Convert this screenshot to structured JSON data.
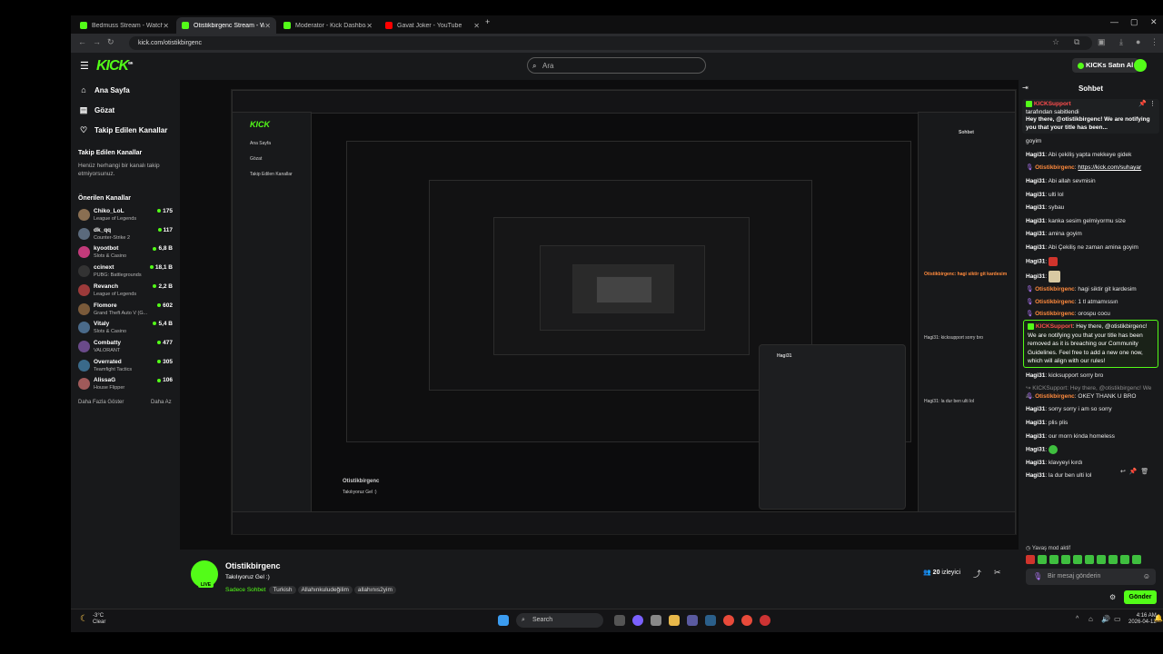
{
  "browser": {
    "tabs": [
      {
        "label": "Bedmuss Stream - Watch Live o",
        "active": false,
        "favicon": "kick-icon"
      },
      {
        "label": "Otistikbirgenc Stream - Watch",
        "active": true,
        "favicon": "kick-icon"
      },
      {
        "label": "Moderator - Kick Dashboard",
        "active": false,
        "favicon": "kick-icon"
      },
      {
        "label": "Gavat Joker - YouTube",
        "active": false,
        "favicon": "youtube-icon"
      }
    ],
    "url": "kick.com/otistikbirgenc"
  },
  "header": {
    "logo": "KICK",
    "logo_sup": "beta",
    "search_placeholder": "Ara",
    "buy_kicks": "KICKs Satın Al"
  },
  "sidebar": {
    "nav": [
      {
        "label": "Ana Sayfa",
        "icon": "home-icon"
      },
      {
        "label": "Gözat",
        "icon": "browse-icon"
      },
      {
        "label": "Takip Edilen Kanallar",
        "icon": "heart-icon"
      }
    ],
    "followed_title": "Takip Edilen Kanallar",
    "followed_empty": "Henüz herhangi bir kanalı takip etmiyorsunuz.",
    "recommended_title": "Önerilen Kanallar",
    "channels": [
      {
        "name": "Chiko_LoL",
        "game": "League of Legends",
        "viewers": "175",
        "color": "#8a6f52"
      },
      {
        "name": "dk_qq",
        "game": "Counter-Strike 2",
        "viewers": "117",
        "color": "#5b6a7c"
      },
      {
        "name": "kyootbot",
        "game": "Slots & Casino",
        "viewers": "6,8 B",
        "color": "#c23a7a"
      },
      {
        "name": "ccinext",
        "game": "PUBG: Battlegrounds",
        "viewers": "18,1 B",
        "color": "#333333"
      },
      {
        "name": "Revanch",
        "game": "League of Legends",
        "viewers": "2,2 B",
        "color": "#9c3a3a"
      },
      {
        "name": "Flomore",
        "game": "Grand Theft Auto V (G...",
        "viewers": "602",
        "color": "#7a5a3a"
      },
      {
        "name": "Vitaly",
        "game": "Slots & Casino",
        "viewers": "5,4 B",
        "color": "#4a6a8a"
      },
      {
        "name": "Combatty",
        "game": "VALORANT",
        "viewers": "477",
        "color": "#6a4a8a"
      },
      {
        "name": "Overrated",
        "game": "Teamfight Tactics",
        "viewers": "305",
        "color": "#3a6a8a"
      },
      {
        "name": "AlissaG",
        "game": "House Flipper",
        "viewers": "106",
        "color": "#a05a5a"
      }
    ],
    "show_more": "Daha Fazla Göster",
    "show_less": "Daha Az"
  },
  "stream_info": {
    "channel": "Otistikbirgenc",
    "title": "Takılıyoruz Gel :)",
    "live_badge": "LIVE",
    "mode": "Sadece Sohbet",
    "tags": [
      "Turkish",
      "Allahınkuludeğilim",
      "allahınıs2yim"
    ],
    "viewers": "20",
    "viewers_label": "izleyici"
  },
  "chat": {
    "title": "Sohbet",
    "pinned": {
      "user": "KICKSupport",
      "pinned_by": "tarafından sabitlendi",
      "text": "Hey there, @otistikbirgenc! We are notifying you that your title has been..."
    },
    "messages": [
      {
        "user": "",
        "text": "goyim",
        "color": "w"
      },
      {
        "user": "Hagi31",
        "text": "Abi çekiliş yapta mekkeye gidek",
        "color": "w"
      },
      {
        "user": "Otistikbirgenc",
        "text": "https://kick.com/suhayar",
        "color": "o",
        "link": true
      },
      {
        "user": "Hagi31",
        "text": "Abi allah sevmisin",
        "color": "w"
      },
      {
        "user": "Hagi31",
        "text": "ulti lol",
        "color": "w"
      },
      {
        "user": "Hagi31",
        "text": "sybau",
        "color": "w"
      },
      {
        "user": "Hagi31",
        "text": "kanka sesim gelmiyormu size",
        "color": "w"
      },
      {
        "user": "Hagi31",
        "text": "amina goyim",
        "color": "w"
      },
      {
        "user": "Hagi31",
        "text": "Abi Çekiliş ne zaman amina goyim",
        "color": "w"
      },
      {
        "user": "Hagi31",
        "text": "",
        "color": "w",
        "emote": "#d0342c"
      },
      {
        "user": "Hagi31",
        "text": "",
        "color": "w",
        "emote": "#d8c9a3",
        "big": true
      },
      {
        "user": "Otistikbirgenc",
        "text": "hagi siktir git kardesim",
        "color": "o"
      },
      {
        "user": "Otistikbirgenc",
        "text": "1 tl atmamıssın",
        "color": "o"
      },
      {
        "user": "Otistikbirgenc",
        "text": "orospu cocu",
        "color": "o"
      }
    ],
    "kick_message": {
      "user": "KICKSupport",
      "text": "Hey there, @otistikbirgenc! We are notifying you that your title has been removed as it is breaching our Community Guidelines. Feel free to add a new one now, which will align with our rules!"
    },
    "messages2": [
      {
        "user": "Hagi31",
        "text": "kicksupport sorry bro",
        "color": "w"
      },
      {
        "user": "",
        "text": "KICKSupport: Hey there, @otistikbirgenc! We a...",
        "color": "dim"
      },
      {
        "user": "Otistikbirgenc",
        "text": "OKEY THANK U BRO",
        "color": "o"
      },
      {
        "user": "Hagi31",
        "text": "sorry sorry i am so sorry",
        "color": "w"
      },
      {
        "user": "Hagi31",
        "text": "plis plis",
        "color": "w"
      },
      {
        "user": "Hagi31",
        "text": "our morn kinda homeless",
        "color": "w"
      },
      {
        "user": "Hagi31",
        "text": "",
        "color": "w",
        "emote": "#3fbf3f",
        "round": true
      },
      {
        "user": "Hagi31",
        "text": "klavyeyi kırdı",
        "color": "w"
      },
      {
        "user": "Hagi31",
        "text": "la dur ben ulti lol",
        "color": "w"
      }
    ],
    "slow_mode": "Yavaş mod aktif",
    "input_placeholder": "Bir mesaj gönderin",
    "send": "Gönder"
  },
  "taskbar": {
    "weather_temp": "-3°C",
    "weather_desc": "Clear",
    "search": "Search",
    "time": "4:16 AM",
    "date": "2026-04-12"
  }
}
